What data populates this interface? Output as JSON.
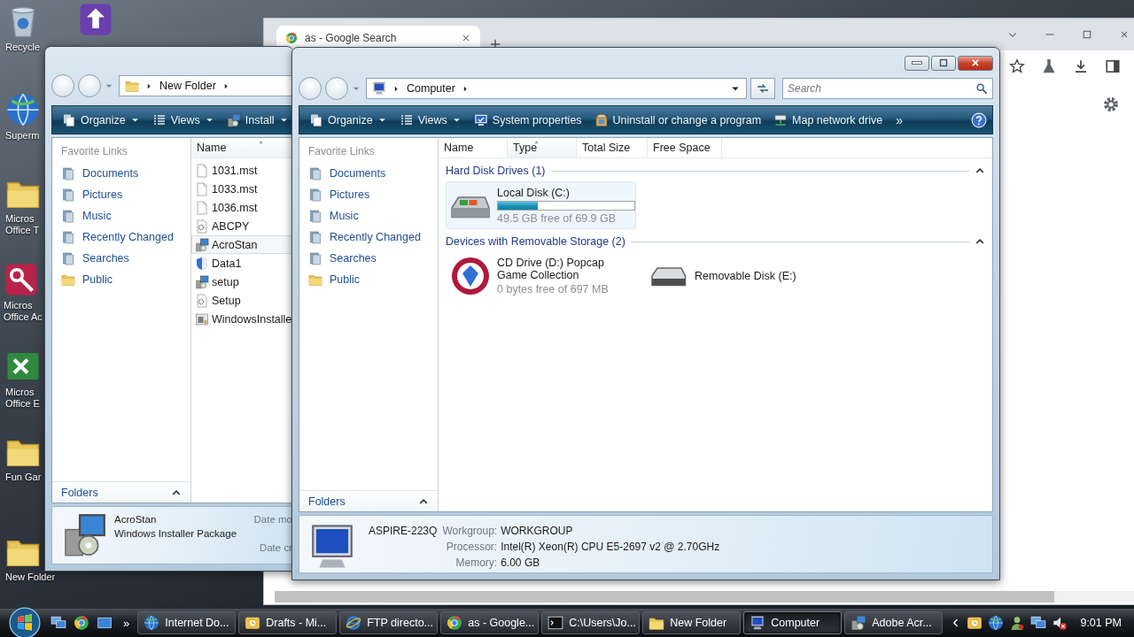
{
  "desktop_icons": [
    {
      "kind": "recycle",
      "label": "Recycle"
    },
    {
      "kind": "app"
    },
    {
      "kind": "globe",
      "label": "Superm"
    },
    {
      "kind": "folder",
      "label": "Micros Office T"
    },
    {
      "kind": "access",
      "label": "Micros Office Ac"
    },
    {
      "kind": "excel",
      "label": "Micros Office E"
    },
    {
      "kind": "folder",
      "label": "Fun Gar"
    },
    {
      "kind": "folder",
      "label": "New Folder"
    }
  ],
  "browser": {
    "tab_title": "as - Google Search"
  },
  "back_window": {
    "location": "New Folder",
    "toolbar": [
      {
        "label": "Organize",
        "kind": "pages",
        "menu": true
      },
      {
        "label": "Views",
        "kind": "list",
        "menu": true
      },
      {
        "label": "Install",
        "kind": "installer",
        "menu": true
      }
    ],
    "favorite_links_title": "Favorite Links",
    "links": [
      {
        "label": "Documents",
        "kind": "library"
      },
      {
        "label": "Pictures",
        "kind": "library"
      },
      {
        "label": "Music",
        "kind": "library"
      },
      {
        "label": "Recently Changed",
        "kind": "library"
      },
      {
        "label": "Searches",
        "kind": "library"
      },
      {
        "label": "Public",
        "kind": "folder"
      }
    ],
    "columns": [
      {
        "label": "Name",
        "sorted": true
      }
    ],
    "files": [
      {
        "name": "1031.mst",
        "kind": "page",
        "selected": false
      },
      {
        "name": "1033.mst",
        "kind": "page",
        "selected": false
      },
      {
        "name": "1036.mst",
        "kind": "page",
        "selected": false
      },
      {
        "name": "ABCPY",
        "kind": "gear-page",
        "selected": false
      },
      {
        "name": "AcroStan",
        "kind": "installer",
        "selected": true
      },
      {
        "name": "Data1",
        "kind": "shield",
        "selected": false
      },
      {
        "name": "setup",
        "kind": "installer",
        "selected": false
      },
      {
        "name": "Setup",
        "kind": "gear-page",
        "selected": false
      },
      {
        "name": "WindowsInstalle",
        "kind": "package",
        "selected": false
      }
    ],
    "folders_label": "Folders",
    "folders_expanded": false,
    "details": {
      "kind": "installer",
      "name": "AcroStan",
      "type": "Windows Installer Package",
      "field_1": "Date mo",
      "field_2": "Date cr"
    }
  },
  "computer_window": {
    "location": "Computer",
    "search_placeholder": "Search",
    "toolbar": [
      {
        "label": "Organize",
        "kind": "pages",
        "menu": true
      },
      {
        "label": "Views",
        "kind": "list",
        "menu": true
      },
      {
        "label": "System properties",
        "kind": "monitor",
        "menu": false
      },
      {
        "label": "Uninstall or change a program",
        "kind": "box",
        "menu": false
      },
      {
        "label": "Map network drive",
        "kind": "network",
        "menu": false
      }
    ],
    "toolbar_overflow": "»",
    "favorite_links_title": "Favorite Links",
    "links": [
      {
        "label": "Documents",
        "kind": "library"
      },
      {
        "label": "Pictures",
        "kind": "library"
      },
      {
        "label": "Music",
        "kind": "library"
      },
      {
        "label": "Recently Changed",
        "kind": "library"
      },
      {
        "label": "Searches",
        "kind": "library"
      },
      {
        "label": "Public",
        "kind": "folder"
      }
    ],
    "columns": [
      {
        "label": "Name",
        "sorted": false
      },
      {
        "label": "Type",
        "sorted": true
      },
      {
        "label": "Total Size",
        "sorted": false
      },
      {
        "label": "Free Space",
        "sorted": false
      }
    ],
    "groups": [
      {
        "title": "Hard Disk Drives (1)",
        "expanded": true,
        "drives": [
          {
            "name": "Local Disk (C:)",
            "kind": "hdd",
            "selected": true,
            "level": 0.29,
            "info": "49.5 GB free of 69.9 GB"
          }
        ]
      },
      {
        "title": "Devices with Removable Storage (2)",
        "expanded": true,
        "drives": [
          {
            "name": "CD Drive (D:) Popcap Game Collection",
            "kind": "cd",
            "selected": false,
            "info": "0 bytes free of 697 MB"
          },
          {
            "name": "Removable Disk (E:)",
            "kind": "removable",
            "selected": false
          }
        ]
      }
    ],
    "folders_label": "Folders",
    "folders_expanded": false,
    "details": {
      "kind": "computer",
      "name": "ASPIRE-223Q",
      "rows": [
        {
          "label": "Workgroup:",
          "value": "WORKGROUP"
        },
        {
          "label": "Processor:",
          "value": "Intel(R) Xeon(R) CPU E5-2697 v2 @ 2.70GHz"
        },
        {
          "label": "Memory:",
          "value": "6.00 GB"
        }
      ]
    }
  },
  "taskbar": {
    "quick_launch_overflow": "»",
    "buttons": [
      {
        "label": "Internet Do...",
        "kind": "globe",
        "selected": false
      },
      {
        "label": "Drafts - Mi...",
        "kind": "mail",
        "selected": false
      },
      {
        "label": "FTP directo...",
        "kind": "ie",
        "selected": false
      },
      {
        "label": "as - Google...",
        "kind": "chrome",
        "selected": false
      },
      {
        "label": "C:\\Users\\Jo...",
        "kind": "cmd",
        "selected": false
      },
      {
        "label": "New Folder",
        "kind": "folder",
        "selected": false
      },
      {
        "label": "Computer",
        "kind": "computer",
        "selected": true
      },
      {
        "label": "Adobe Acr...",
        "kind": "installer",
        "selected": false
      }
    ],
    "time": "9:01 PM"
  }
}
